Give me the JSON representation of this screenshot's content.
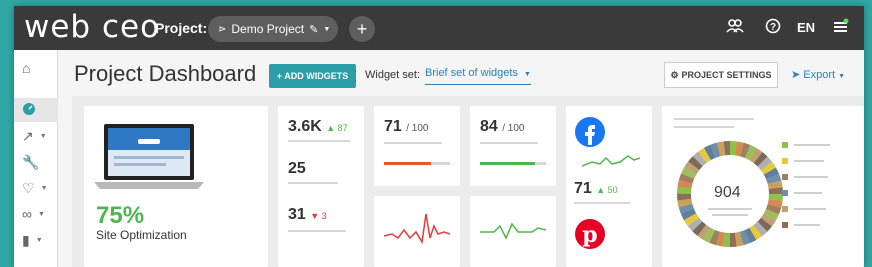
{
  "app": {
    "logo_text": "web ceo",
    "project_label": "Project:",
    "project_name": "Demo Project",
    "language": "EN"
  },
  "toolbar": {
    "page_title": "Project Dashboard",
    "add_widgets_label": "+ ADD WIDGETS",
    "widget_set_label": "Widget set:",
    "widget_set_value": "Brief set of widgets",
    "settings_label": "PROJECT SETTINGS",
    "export_label": "Export"
  },
  "sidebar": {
    "items": [
      "home-icon",
      "dashboard-icon",
      "chart-icon",
      "wrench-icon",
      "heartbeat-icon",
      "link-icon",
      "bars-icon"
    ]
  },
  "widgets": {
    "site_optimization": {
      "value": "75%",
      "label": "Site Optimization"
    },
    "metric_1": {
      "value": "3.6K",
      "delta": "87",
      "trend": "up"
    },
    "metric_2": {
      "value": "25"
    },
    "metric_3": {
      "value": "31",
      "delta": "3",
      "trend": "down"
    },
    "score_1": {
      "value": "71",
      "max": "/ 100",
      "fill": 0.71,
      "color": "#e8562a"
    },
    "score_2": {
      "value": "84",
      "max": "/ 100",
      "fill": 0.84,
      "color": "#4cb84c"
    },
    "facebook": {
      "value": "71",
      "delta": "50"
    },
    "donut": {
      "value": "904"
    }
  },
  "colors": {
    "accent": "#2c9ea8",
    "link": "#2b7fbf",
    "green": "#4cb84c",
    "red": "#e23b3b",
    "topbar": "#3a3a3a"
  }
}
